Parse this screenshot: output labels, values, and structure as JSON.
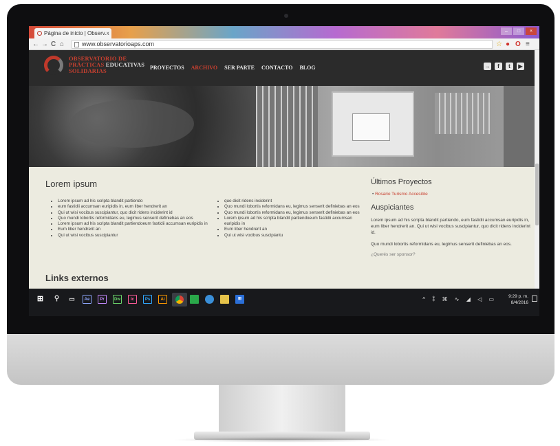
{
  "browser": {
    "tab_title": "Página de inicio | Observ...",
    "tab_close": "×",
    "back": "←",
    "forward": "→",
    "reload": "C",
    "home": "⌂",
    "url": "www.observatorioaps.com",
    "star": "☆",
    "ext_badge": "●",
    "ext_opera": "O",
    "menu": "≡",
    "win_min": "–",
    "win_max": "□",
    "win_close": "×"
  },
  "site": {
    "logo_line1": "OBSERVATORIO DE",
    "logo_line2a": "PRÁCTICAS",
    "logo_line2b": "EDUCATIVAS",
    "logo_line3": "SOLIDARIAS",
    "nav": [
      "PROYECTOS",
      "ARCHIVO",
      "SER PARTE",
      "CONTACTO",
      "BLOG"
    ],
    "active_nav": "ARCHIVO",
    "social": [
      "→",
      "f",
      "t",
      "▶"
    ],
    "accent": "#c84030"
  },
  "content": {
    "heading": "Lorem ipsum",
    "list_left": [
      "Lorem ipsum ad his scripta blandit partiendo",
      "eum fastidii accumsan euripidis in, eum liber hendrerit an",
      "Qui ut wisi vocibus suscipiantur, quo dicit ridens inciderint id",
      "Quo mundi lobortis reformidans eu, legimus senserit definiebas an eos",
      "Lorem ipsum ad his scripta blandit partiendoeum fastidii accumsan euripidis in",
      "Eum liber hendrerit an",
      "Qui ut wisi vocibus suscipiantur"
    ],
    "list_right": [
      "quo dicit ridens inciderint",
      "Quo mundi lobortis reformidans eu, legimus senserit definiebas an eos",
      "Quo mundi lobortis reformidans eu, legimus senserit definiebas an eos",
      "Lorem ipsum ad his scripta blandit partiendoeum fastidii accumsan euripidis in",
      "Eum liber hendrerit an",
      "Qui ut wisi vocibus suscipiantu"
    ],
    "links_heading": "Links externos"
  },
  "sidebar": {
    "projects_heading": "Últimos Proyectos",
    "project_item": "Rosario Turismo Accesible",
    "sponsors_heading": "Auspiciantes",
    "para1": "Lorem ipsum ad his scripta blandit partiendo, eum fastidii accumsan euripidis in, eum liber hendrerit an. Qui ut wisi vocibus suscipiantur, quo dicit ridens inciderint id.",
    "para2": "Quo mundi lobortis reformidans eu, legimus senserit definiebas an eos.",
    "sponsor_link": "¿Querés ser sponsor?"
  },
  "taskbar": {
    "apps": [
      "Ae",
      "Pr",
      "Dw",
      "Ic",
      "Ps",
      "Ai"
    ],
    "tray": "^ ⁑ ⌘ ∿ ◢ ◁ ▭",
    "time": "9:29 p. m.",
    "date": "8/4/2016"
  }
}
